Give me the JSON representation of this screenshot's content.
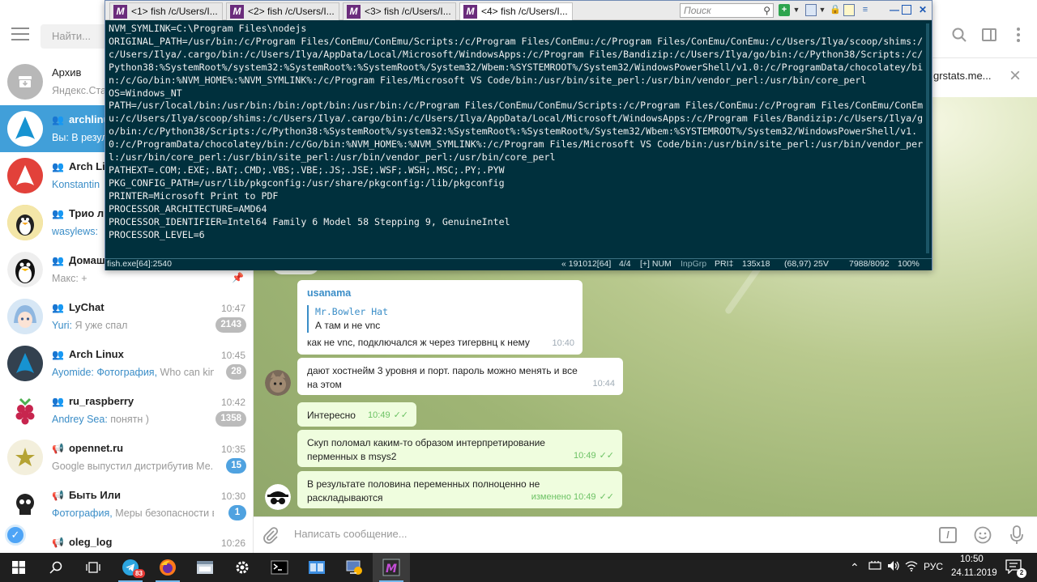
{
  "telegram": {
    "search_placeholder": "Найти...",
    "chats": [
      {
        "title": "Архив",
        "preview_sender": "",
        "preview": "Яндекс.Ста",
        "time": "",
        "badge": "",
        "group": false
      },
      {
        "title": "archlinux",
        "preview_sender": "",
        "preview": "Вы: В резул",
        "time": "",
        "badge": "",
        "group": true
      },
      {
        "title": "Arch Lin",
        "preview_sender": "Konstantin",
        "preview": "",
        "time": "",
        "badge": "",
        "group": true
      },
      {
        "title": "Трио ли",
        "preview_sender": "wasylews:",
        "preview": "",
        "time": "",
        "badge": "",
        "group": true
      },
      {
        "title": "Домаш",
        "preview_sender": "",
        "preview": "Макс: +",
        "time": "",
        "badge": "",
        "group": true
      },
      {
        "title": "LyChat",
        "preview_sender": "Yuri:",
        "preview": "Я уже спал",
        "time": "10:47",
        "badge": "2143",
        "group": true
      },
      {
        "title": "Arch Linux",
        "preview_sender": "Ayomide: Фотография,",
        "preview": "Who can kin...",
        "time": "10:45",
        "badge": "28",
        "group": true
      },
      {
        "title": "ru_raspberry",
        "preview_sender": "Andrey Sea:",
        "preview": "понятн )",
        "time": "10:42",
        "badge": "1358",
        "group": true
      },
      {
        "title": "opennet.ru",
        "preview_sender": "",
        "preview": "Google выпустил дистрибутив Ме...",
        "time": "10:35",
        "badge": "15",
        "group": false
      },
      {
        "title": "Быть Или",
        "preview_sender": "Фотография,",
        "preview": "Меры безопасности в...",
        "time": "10:30",
        "badge": "1",
        "group": false
      },
      {
        "title": "oleg_log",
        "preview_sender": "",
        "preview": "",
        "time": "10:26",
        "badge": "",
        "group": false
      }
    ],
    "pinned_url": "grstats.me...",
    "compose_placeholder": "Написать сообщение...",
    "messages": [
      {
        "author": "usanama",
        "quote_author": "Mr.Bowler Hat",
        "quote_text": "А там и не vnc",
        "text": "как не vnc, подключался ж через тигервнц к нему",
        "time": "10:40"
      },
      {
        "text": "дают хостнейм 3 уровня и порт. пароль можно менять и все на этом",
        "time": "10:44"
      },
      {
        "text": "Интересно",
        "time": "10:49"
      },
      {
        "text": "Скуп поломал каким-то образом интерпретирование перменных в msys2",
        "time": "10:49"
      },
      {
        "text": "В результате половина переменных полноценно не раскладываются",
        "time": "изменено 10:49"
      }
    ],
    "colors": {
      "accent": "#419fd9",
      "out_bubble": "#effdde"
    }
  },
  "conemu": {
    "tabs": [
      "<1> fish /c/Users/I...",
      "<2> fish /c/Users/I...",
      "<3> fish /c/Users/I...",
      "<4> fish /c/Users/I..."
    ],
    "search_placeholder": "Поиск",
    "console_lines": [
      "NVM_SYMLINK=C:\\Program Files\\nodejs",
      "ORIGINAL_PATH=/usr/bin:/c/Program Files/ConEmu/ConEmu/Scripts:/c/Program Files/ConEmu:/c/Program Files/ConEmu/ConEmu:/c/Users/Ilya/scoop/shims:/c/Users/Ilya/.cargo/bin:/c/Users/Ilya/AppData/Local/Microsoft/WindowsApps:/c/Program Files/Bandizip:/c/Users/Ilya/go/bin:/c/Python38/Scripts:/c/Python38:%SystemRoot%/system32:%SystemRoot%:%SystemRoot%/System32/Wbem:%SYSTEMROOT%/System32/WindowsPowerShell/v1.0:/c/ProgramData/chocolatey/bin:/c/Go/bin:%NVM_HOME%:%NVM_SYMLINK%:/c/Program Files/Microsoft VS Code/bin:/usr/bin/site_perl:/usr/bin/vendor_perl:/usr/bin/core_perl",
      "OS=Windows_NT",
      "PATH=/usr/local/bin:/usr/bin:/bin:/opt/bin:/usr/bin:/c/Program Files/ConEmu/ConEmu/Scripts:/c/Program Files/ConEmu:/c/Program Files/ConEmu/ConEmu:/c/Users/Ilya/scoop/shims:/c/Users/Ilya/.cargo/bin:/c/Users/Ilya/AppData/Local/Microsoft/WindowsApps:/c/Program Files/Bandizip:/c/Users/Ilya/go/bin:/c/Python38/Scripts:/c/Python38:%SystemRoot%/system32:%SystemRoot%:%SystemRoot%/System32/Wbem:%SYSTEMROOT%/System32/WindowsPowerShell/v1.0:/c/ProgramData/chocolatey/bin:/c/Go/bin:%NVM_HOME%:%NVM_SYMLINK%:/c/Program Files/Microsoft VS Code/bin:/usr/bin/site_perl:/usr/bin/vendor_perl:/usr/bin/core_perl:/usr/bin/site_perl:/usr/bin/vendor_perl:/usr/bin/core_perl",
      "PATHEXT=.COM;.EXE;.BAT;.CMD;.VBS;.VBE;.JS;.JSE;.WSF;.WSH;.MSC;.PY;.PYW",
      "PKG_CONFIG_PATH=/usr/lib/pkgconfig:/usr/share/pkgconfig:/lib/pkgconfig",
      "PRINTER=Microsoft Print to PDF",
      "PROCESSOR_ARCHITECTURE=AMD64",
      "PROCESSOR_IDENTIFIER=Intel64 Family 6 Model 58 Stepping 9, GenuineIntel",
      "PROCESSOR_LEVEL=6"
    ],
    "status": {
      "process": "fish.exe[64]:2540",
      "pid": "« 191012[64]",
      "tab_index": "4/4",
      "flags": "[+] NUM",
      "inpgrp": "InpGrp",
      "pri": "PRI‡",
      "size": "135x18",
      "cursor": "(68,97) 25V",
      "buffer": "7988/8092",
      "zoom": "100%"
    },
    "colors": {
      "console_bg": "#00303d",
      "console_fg": "#f0f0f0"
    }
  },
  "taskbar": {
    "lang": "РУС",
    "time": "10:50",
    "date": "24.11.2019",
    "telegram_badge": "83",
    "notifications_count": "2"
  }
}
